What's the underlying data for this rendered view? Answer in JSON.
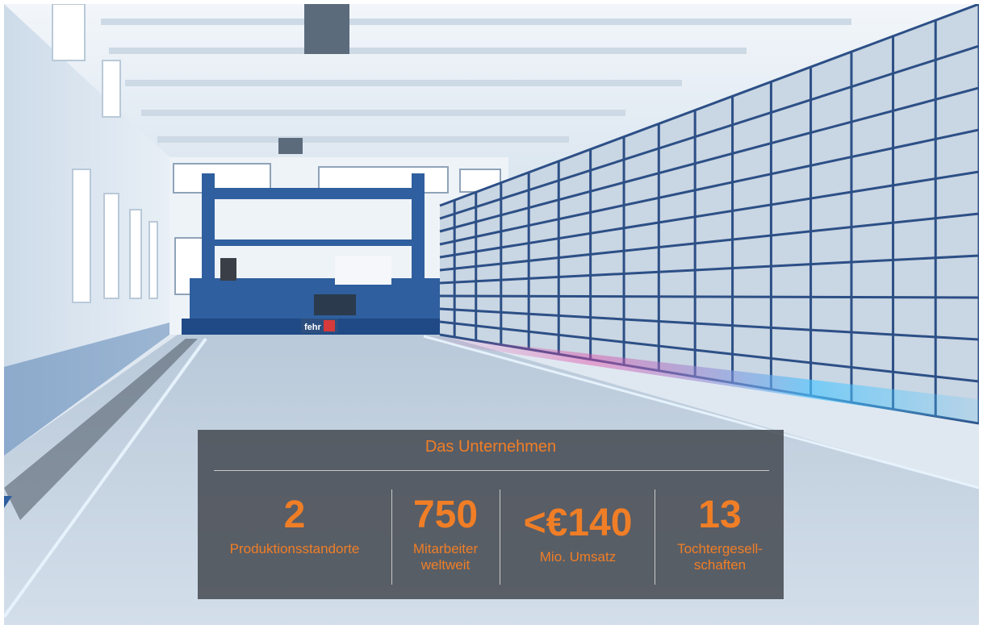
{
  "company": {
    "title": "Das Unternehmen",
    "logo_text": "fehr",
    "stats": [
      {
        "number": "2",
        "label_line1": "Produktionsstandorte",
        "label_line2": ""
      },
      {
        "number": "750",
        "label_line1": "Mitarbeiter",
        "label_line2": "weltweit"
      },
      {
        "number": "<€140",
        "label_line1": "Mio. Umsatz",
        "label_line2": ""
      },
      {
        "number": "13",
        "label_line1": "Tochtergesell-",
        "label_line2": "schaften"
      }
    ]
  },
  "colors": {
    "accent": "#f07e26",
    "panel": "#484c54",
    "rack": "#2c4f86",
    "crane": "#2f5f9e"
  }
}
